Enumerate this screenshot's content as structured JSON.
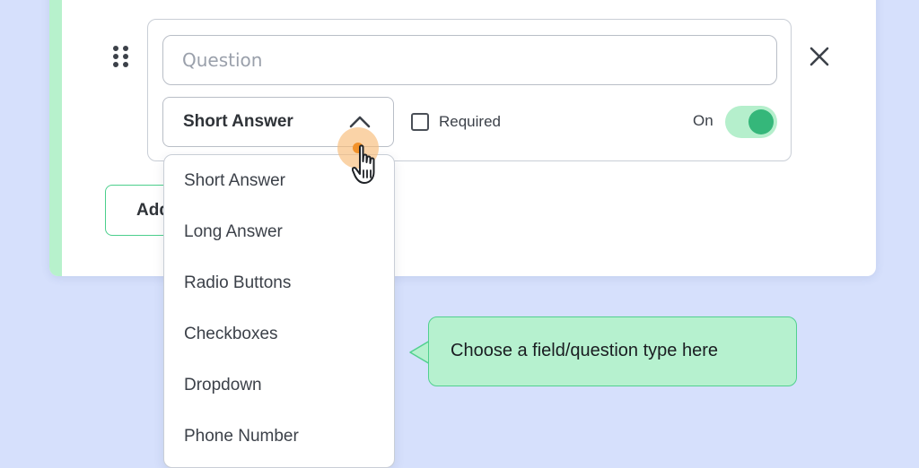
{
  "question_editor": {
    "question_placeholder": "Question",
    "field_type_selected": "Short Answer",
    "required_label": "Required",
    "required_checked": false,
    "toggle_label": "On",
    "toggle_on": true,
    "add_button_label": "Add"
  },
  "dropdown": {
    "options": [
      "Short Answer",
      "Long Answer",
      "Radio Buttons",
      "Checkboxes",
      "Dropdown",
      "Phone Number"
    ]
  },
  "callout": {
    "text": "Choose a field/question type here"
  },
  "icons": {
    "drag": "drag-handle-icon",
    "close": "close-icon",
    "chevron": "chevron-up-icon",
    "cursor": "hand-pointer-icon"
  },
  "colors": {
    "background": "#d6e0fc",
    "accent_green": "#35b77a",
    "light_green": "#b6f1cf",
    "highlight_orange": "#f2922b"
  }
}
